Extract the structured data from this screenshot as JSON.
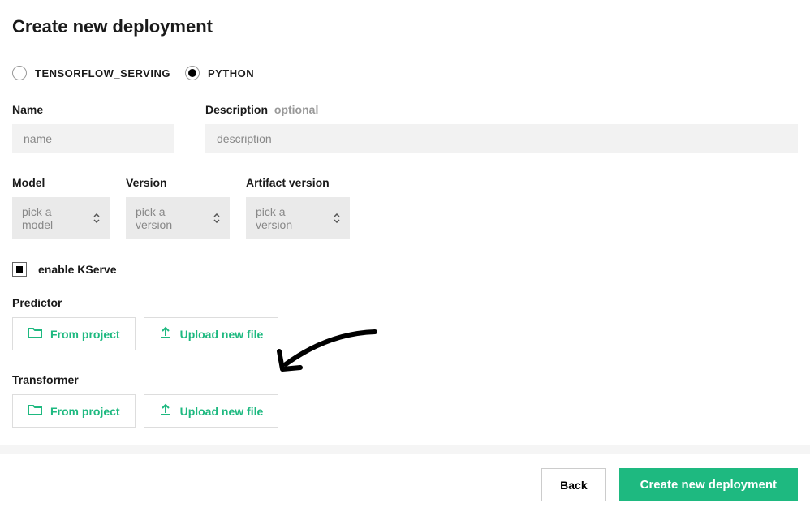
{
  "header": {
    "title": "Create new deployment"
  },
  "serving_type": {
    "options": [
      {
        "value": "tensorflow",
        "label": "TENSORFLOW_SERVING",
        "selected": false
      },
      {
        "value": "python",
        "label": "PYTHON",
        "selected": true
      }
    ]
  },
  "fields": {
    "name": {
      "label": "Name",
      "placeholder": "name",
      "value": ""
    },
    "description": {
      "label": "Description",
      "optional": "optional",
      "placeholder": "description",
      "value": ""
    },
    "model": {
      "label": "Model",
      "placeholder": "pick a model"
    },
    "version": {
      "label": "Version",
      "placeholder": "pick a version"
    },
    "artifact_version": {
      "label": "Artifact version",
      "placeholder": "pick a version"
    }
  },
  "kserve": {
    "label": "enable KServe",
    "checked": true
  },
  "predictor": {
    "label": "Predictor",
    "from_project": "From project",
    "upload": "Upload new file"
  },
  "transformer": {
    "label": "Transformer",
    "from_project": "From project",
    "upload": "Upload new file"
  },
  "footer": {
    "back": "Back",
    "create": "Create new deployment"
  }
}
